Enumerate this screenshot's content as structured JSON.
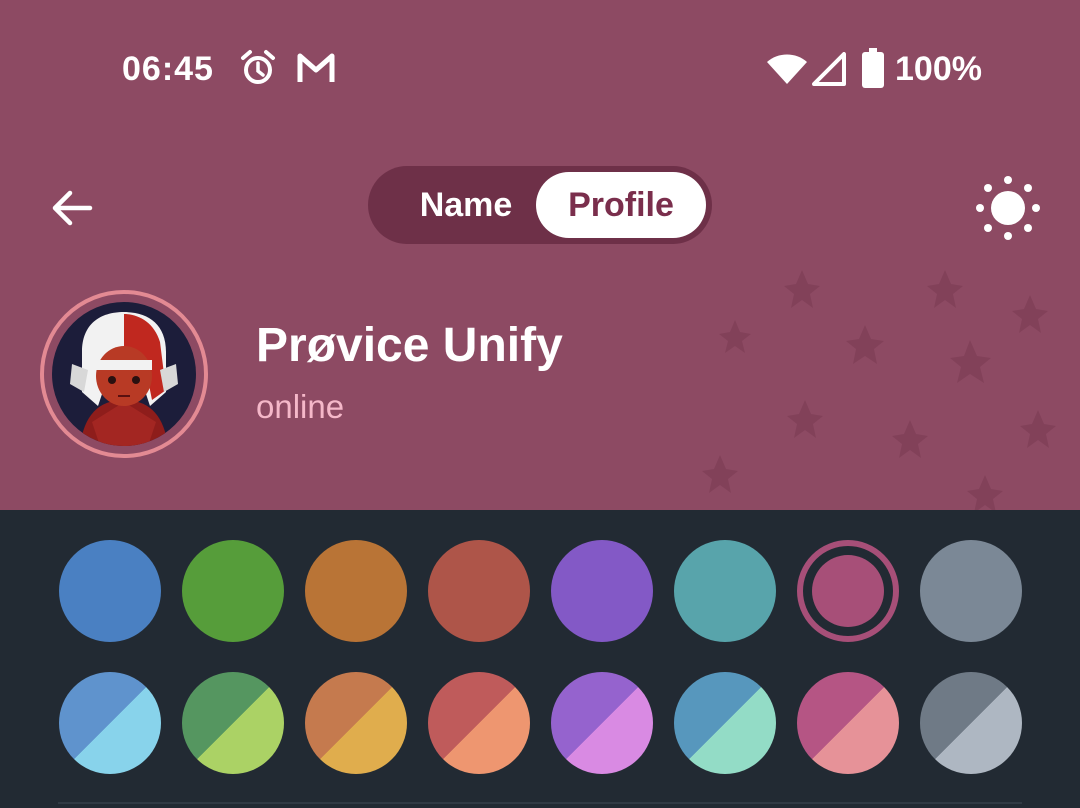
{
  "status_bar": {
    "time": "06:45",
    "battery": "100%"
  },
  "toolbar": {
    "tab_name": "Name",
    "tab_profile": "Profile"
  },
  "profile": {
    "name": "Prøvice Unify",
    "status": "online"
  },
  "colors": {
    "header_bg": "#8d4a63",
    "panel_bg": "#222a33",
    "solid": [
      "#4a80c2",
      "#569d3a",
      "#b97436",
      "#ae5549",
      "#8359c6",
      "#58a4ab",
      "#a74f78",
      "#7b8896"
    ],
    "gradient_top": [
      "#5f93cd",
      "#559660",
      "#c57a4e",
      "#bf5b5b",
      "#9563ce",
      "#5797bd",
      "#b55584",
      "#6f7a86"
    ],
    "gradient_bottom": [
      "#88d3eb",
      "#abd265",
      "#e0ad4d",
      "#ee9670",
      "#d98ae3",
      "#93dcc6",
      "#e69298",
      "#aeb7c2"
    ],
    "selected_index": 6
  }
}
